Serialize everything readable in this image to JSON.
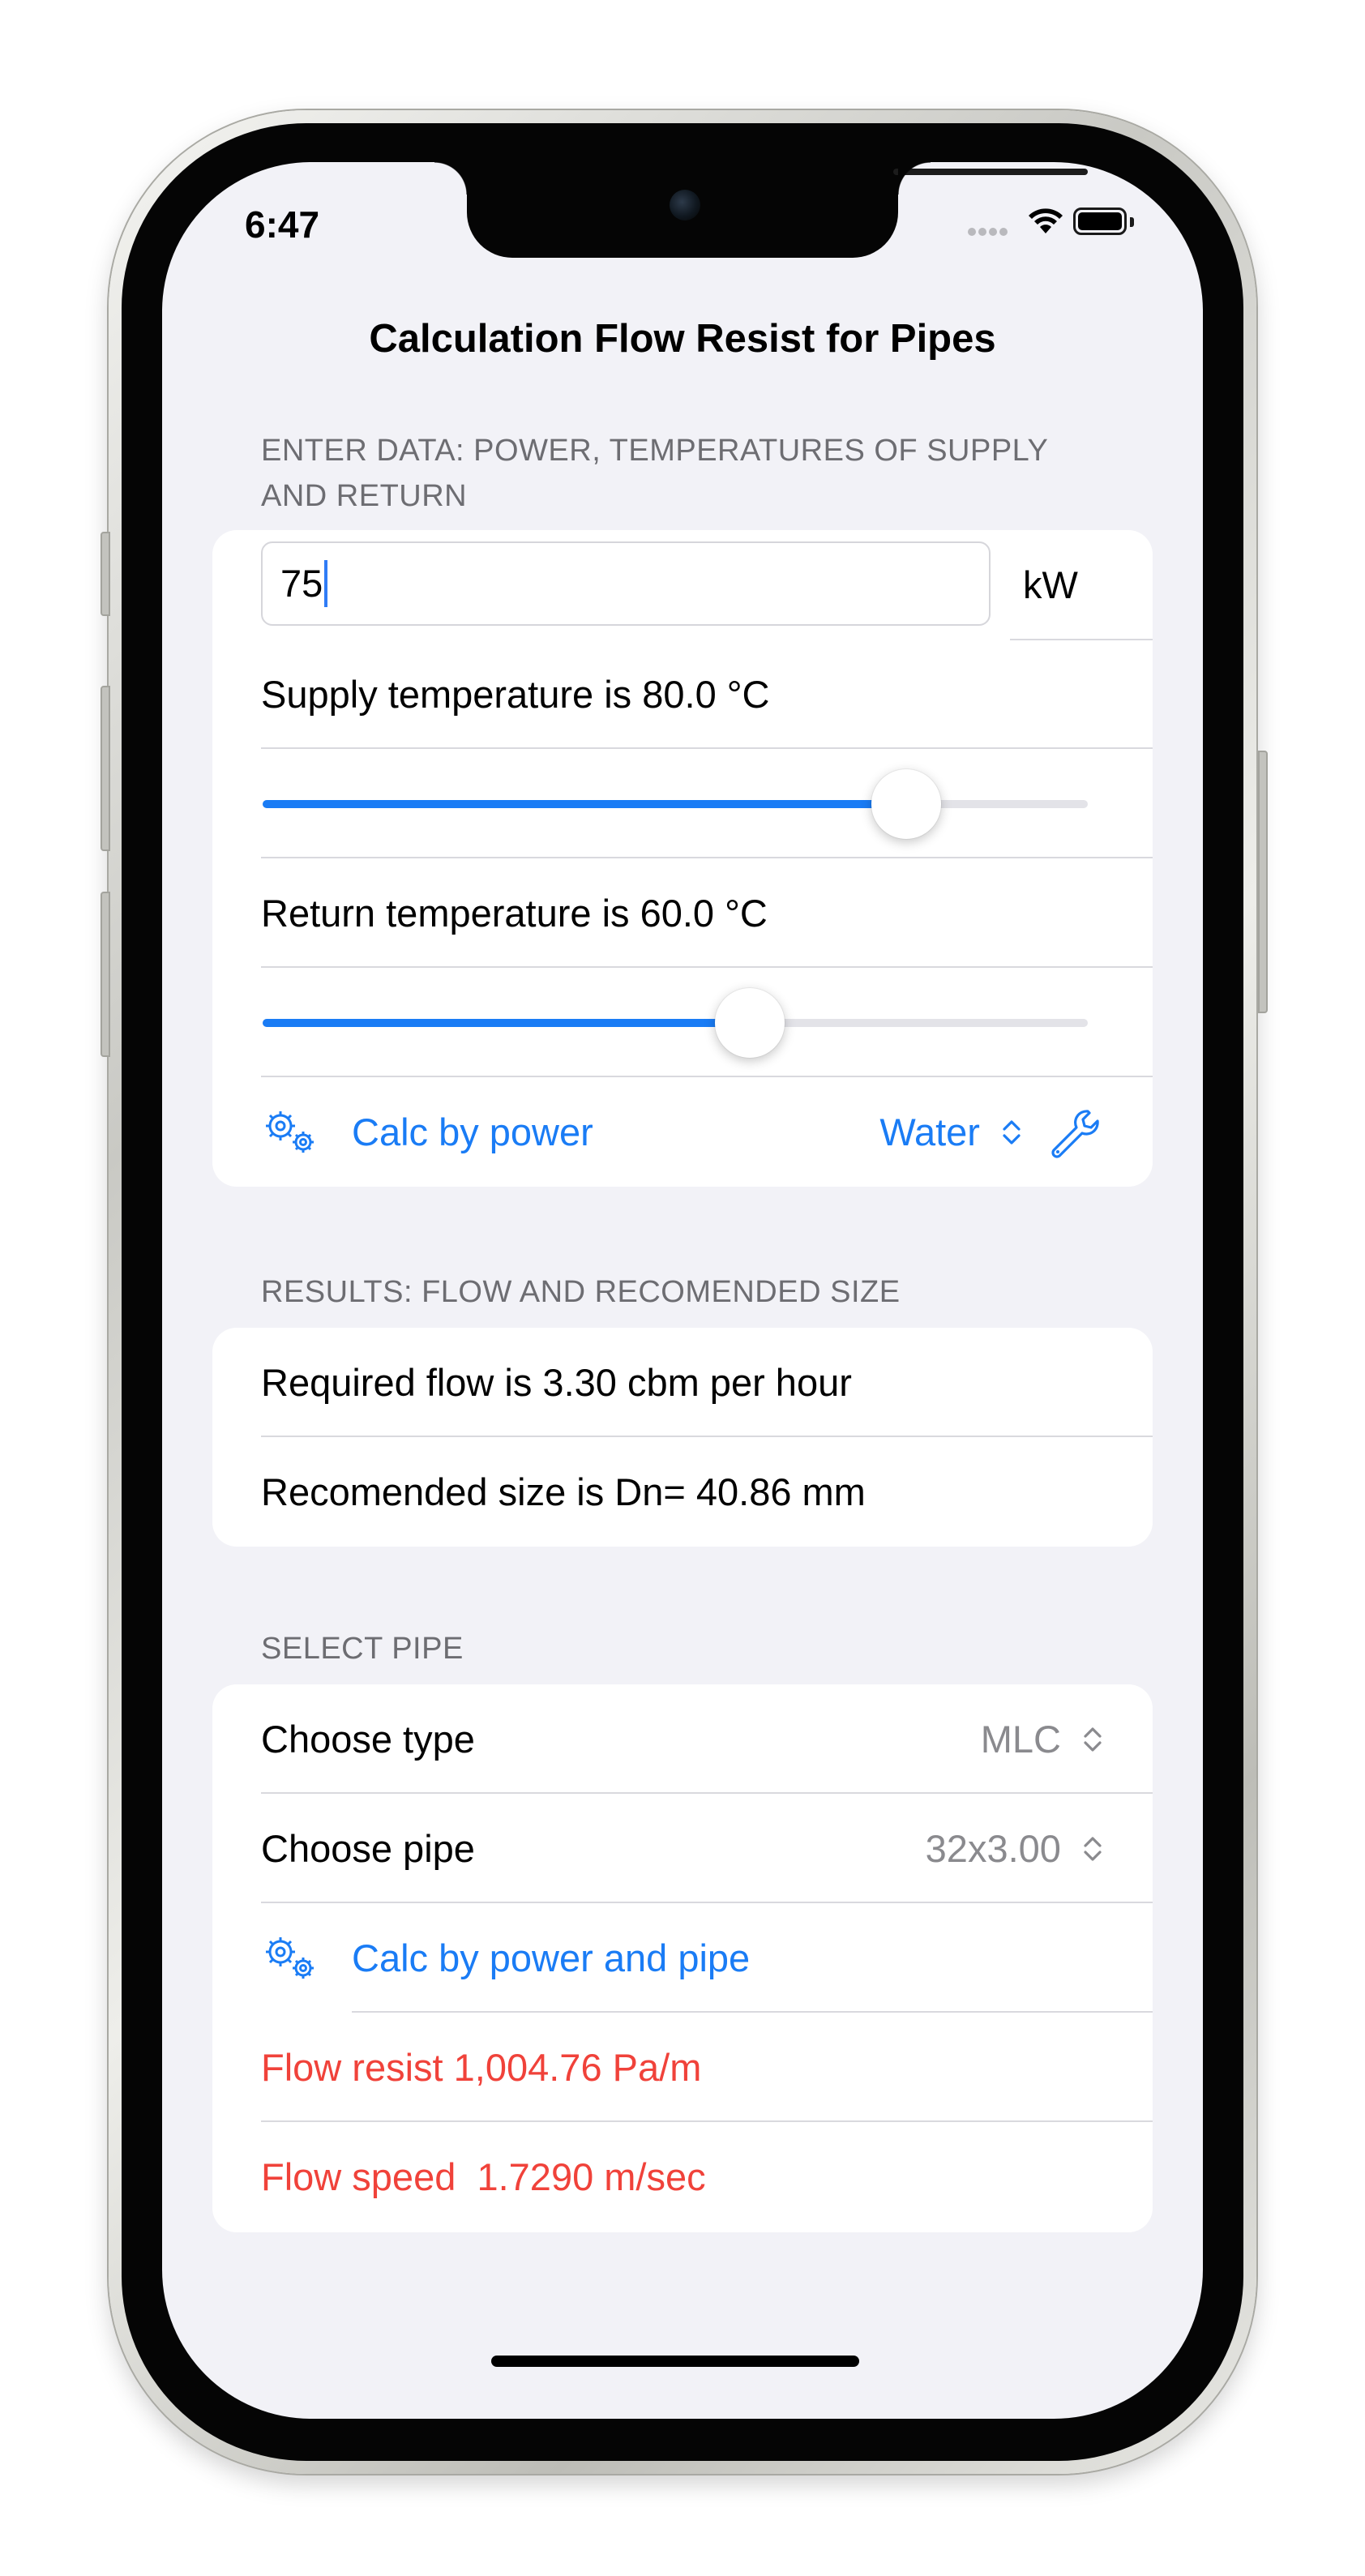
{
  "status_bar": {
    "time": "6:47"
  },
  "app": {
    "title": "Calculation Flow Resist for Pipes"
  },
  "input_section": {
    "header": "ENTER DATA: POWER, TEMPERATURES OF SUPPLY AND RETURN",
    "power_value": "75",
    "power_unit": "kW",
    "supply_label": "Supply temperature is 80.0 °C",
    "supply_slider_fraction": 0.78,
    "return_label": "Return temperature is 60.0 °C",
    "return_slider_fraction": 0.59,
    "calc_button": "Calc by power",
    "fluid_picker": "Water",
    "icons": [
      "gears-icon",
      "wrench-icon",
      "chevron-updown-icon"
    ]
  },
  "results_section": {
    "header": "RESULTS: FLOW AND RECOMENDED SIZE",
    "flow": "Required flow is 3.30 cbm per hour",
    "size": "Recomended size is Dn= 40.86 mm"
  },
  "pipe_section": {
    "header": "SELECT PIPE",
    "type_label": "Choose type",
    "type_value": "MLC",
    "pipe_label": "Choose pipe",
    "pipe_value": "32x3.00",
    "calc_button": "Calc by power and pipe",
    "flow_resist": "Flow resist 1,004.76 Pa/m",
    "flow_speed": "Flow speed  1.7290 m/sec"
  },
  "colors": {
    "accent": "#1a7cf5",
    "warning": "#f0423a",
    "background": "#f2f2f7"
  }
}
